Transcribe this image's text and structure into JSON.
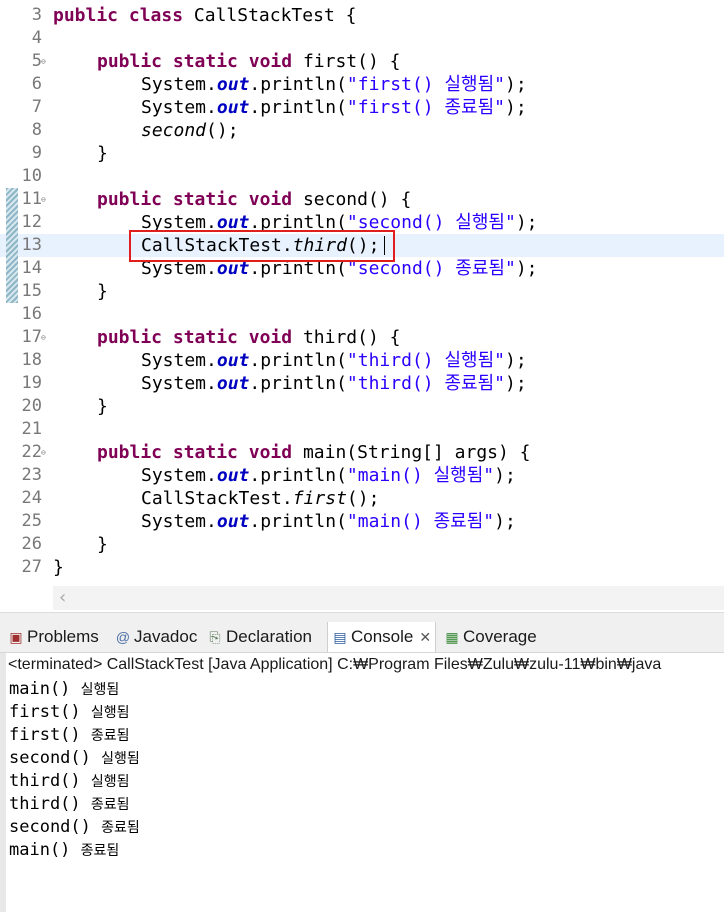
{
  "editor": {
    "lines": [
      {
        "n": "3"
      },
      {
        "n": "4"
      },
      {
        "n": "5"
      },
      {
        "n": "6"
      },
      {
        "n": "7"
      },
      {
        "n": "8"
      },
      {
        "n": "9"
      },
      {
        "n": "10"
      },
      {
        "n": "11"
      },
      {
        "n": "12"
      },
      {
        "n": "13"
      },
      {
        "n": "14"
      },
      {
        "n": "15"
      },
      {
        "n": "16"
      },
      {
        "n": "17"
      },
      {
        "n": "18"
      },
      {
        "n": "19"
      },
      {
        "n": "20"
      },
      {
        "n": "21"
      },
      {
        "n": "22"
      },
      {
        "n": "23"
      },
      {
        "n": "24"
      },
      {
        "n": "25"
      },
      {
        "n": "26"
      },
      {
        "n": "27"
      }
    ],
    "tokens": {
      "kw_public": "public",
      "kw_class": "class",
      "kw_static": "static",
      "kw_void": "void",
      "class_decl": " CallStackTest {",
      "system_dot": "System.",
      "field_out": "out",
      "println_open": ".println(",
      "close_paren_semi": ");",
      "close_brace": "}",
      "first_sig": " first() {",
      "second_sig": " second() {",
      "third_sig": " third() {",
      "main_sig": " main(String[] args) {",
      "str_first_run": "\"first() 실행됨\"",
      "str_first_end": "\"first() 종료됨\"",
      "str_second_run": "\"second() 실행됨\"",
      "str_second_end": "\"second() 종료됨\"",
      "str_third_run": "\"third() 실행됨\"",
      "str_third_end": "\"third() 종료됨\"",
      "str_main_run": "\"main() 실행됨\"",
      "str_main_end": "\"main() 종료됨\"",
      "call_second": "second",
      "call_parens": "();",
      "class_ref": "CallStackTest.",
      "call_third": "third",
      "call_first": "first"
    },
    "fold_icon": "collapse-icon"
  },
  "console": {
    "tabs": [
      {
        "label": "Problems",
        "icon": "problems-icon"
      },
      {
        "label": "Javadoc",
        "icon": "at-sign-icon"
      },
      {
        "label": "Declaration",
        "icon": "declaration-icon"
      },
      {
        "label": "Console",
        "icon": "console-icon",
        "close": "✕"
      },
      {
        "label": "Coverage",
        "icon": "coverage-icon"
      }
    ],
    "status": "<terminated> CallStackTest [Java Application] C:₩Program Files₩Zulu₩zulu-11₩bin₩java",
    "output": [
      {
        "code": "main()",
        "ko": "실행됨"
      },
      {
        "code": "first()",
        "ko": "실행됨"
      },
      {
        "code": "first()",
        "ko": "종료됨"
      },
      {
        "code": "second()",
        "ko": "실행됨"
      },
      {
        "code": "third()",
        "ko": "실행됨"
      },
      {
        "code": "third()",
        "ko": "종료됨"
      },
      {
        "code": "second()",
        "ko": "종료됨"
      },
      {
        "code": "main()",
        "ko": "종료됨"
      }
    ]
  }
}
